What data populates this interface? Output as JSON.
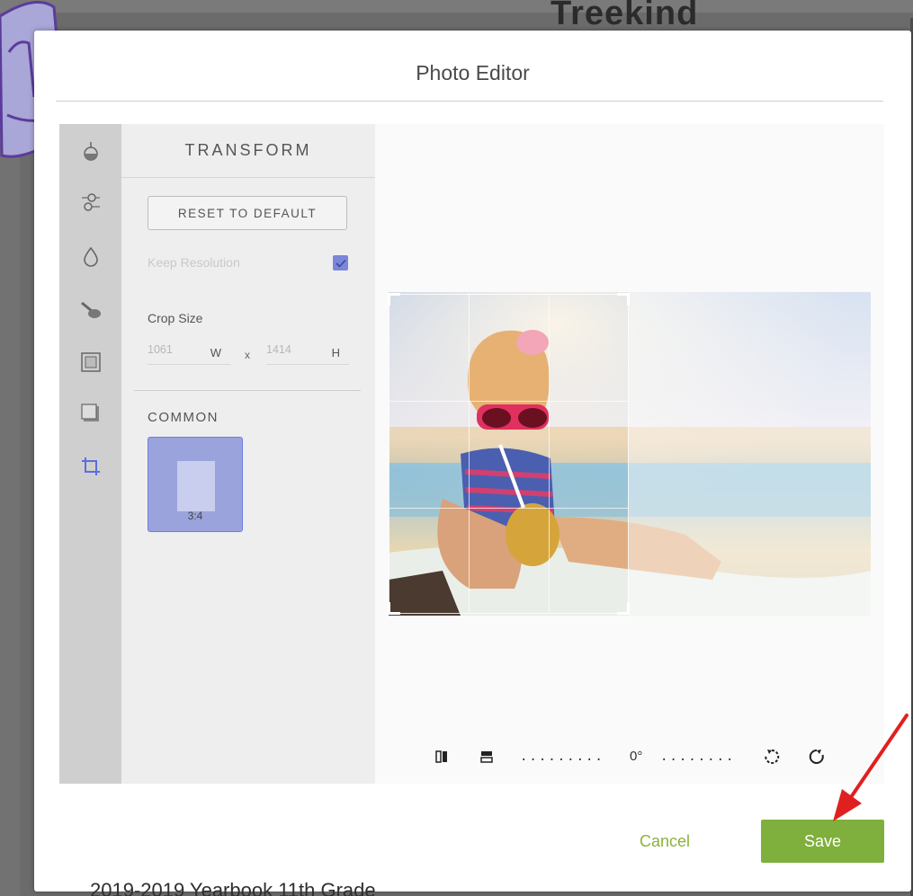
{
  "background": {
    "heading_fragment": "Treekind",
    "bottom_text": "2019-2019 Yearbook 11th Grade"
  },
  "modal": {
    "title": "Photo Editor"
  },
  "rail": {
    "icons": [
      "adjust-icon",
      "filters-icon",
      "color-drop-icon",
      "brush-icon",
      "frame-icon",
      "shadow-frame-icon",
      "crop-icon"
    ],
    "active": "crop-icon",
    "accent": "#5a6fe0"
  },
  "panel": {
    "header": "TRANSFORM",
    "reset_label": "RESET TO DEFAULT",
    "keep_resolution_label": "Keep Resolution",
    "keep_resolution_checked": true,
    "crop_size_label": "Crop Size",
    "crop_width": "1061",
    "crop_width_unit": "W",
    "crop_separator": "x",
    "crop_height": "1414",
    "crop_height_unit": "H",
    "common_label": "COMMON",
    "ratio_option": "3:4"
  },
  "toolbar": {
    "angle_value": "0°",
    "left_dots": ".........",
    "right_dots": "........"
  },
  "footer": {
    "cancel_label": "Cancel",
    "save_label": "Save",
    "save_color": "#7faf3c",
    "cancel_color": "#8cb23e"
  },
  "annotation": {
    "arrow_color": "#e02020"
  }
}
